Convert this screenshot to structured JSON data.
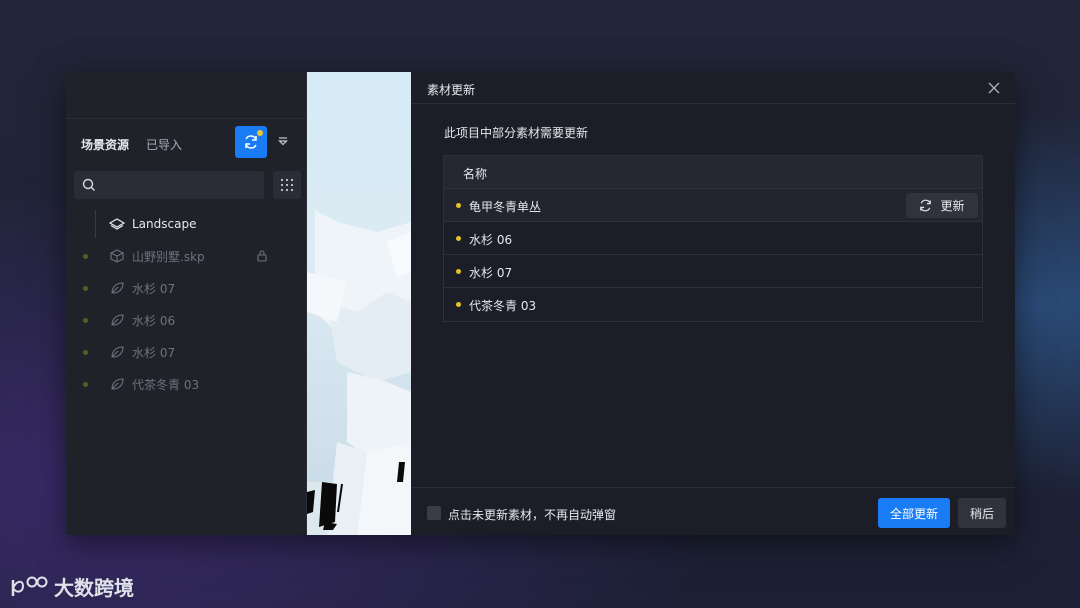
{
  "left_panel": {
    "tabs": [
      {
        "label": "场景资源"
      },
      {
        "label": "已导入"
      }
    ],
    "search": {
      "placeholder": ""
    },
    "tree": [
      {
        "label": "Landscape",
        "icon": "layers-icon"
      },
      {
        "label": "山野别墅.skp",
        "icon": "cube-icon"
      },
      {
        "label": "水杉 07",
        "icon": "leaf-icon"
      },
      {
        "label": "水杉 06",
        "icon": "leaf-icon"
      },
      {
        "label": "水杉 07",
        "icon": "leaf-icon"
      },
      {
        "label": "代茶冬青 03",
        "icon": "leaf-icon"
      }
    ]
  },
  "dialog": {
    "title": "素材更新",
    "notice": "此项目中部分素材需要更新",
    "table": {
      "header": "名称",
      "rows": [
        {
          "name": "龟甲冬青单丛",
          "action": "更新"
        },
        {
          "name": "水杉 06"
        },
        {
          "name": "水杉 07"
        },
        {
          "name": "代茶冬青 03"
        }
      ]
    },
    "footer": {
      "checkbox_label": "点击未更新素材，不再自动弹窗",
      "primary": "全部更新",
      "secondary": "稍后"
    }
  },
  "watermark": {
    "text": "大数跨境"
  },
  "colors": {
    "accent": "#1a7cf5",
    "status_dot": "#e3c52a"
  }
}
